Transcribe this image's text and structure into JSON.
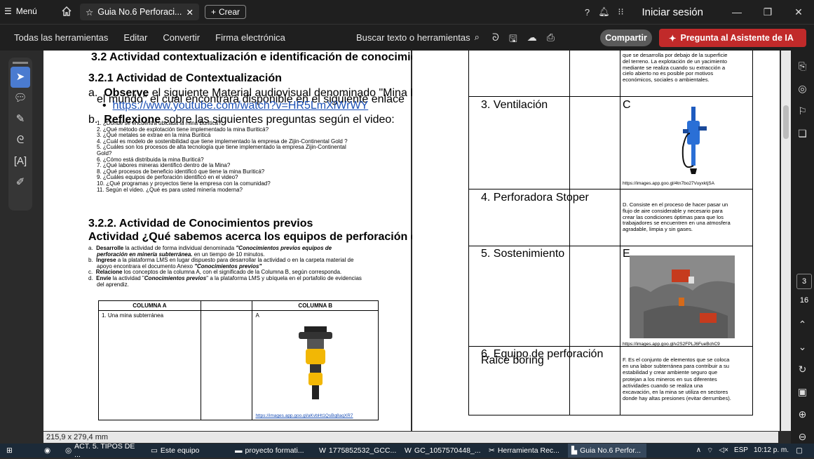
{
  "titlebar": {
    "menu_label": "Menú",
    "tab_title": "Guia No.6 Perforaci...",
    "new_tab": "Crear",
    "signin": "Iniciar sesión"
  },
  "toolbar": {
    "items": [
      "Todas las herramientas",
      "Editar",
      "Convertir",
      "Firma electrónica"
    ],
    "search": "Buscar texto o herramientas",
    "share": "Compartir",
    "ai": "Pregunta al Asistente de IA"
  },
  "page1": {
    "heading": "3.2 Actividad contextualización e identificación de conocimientos previos",
    "s321": "3.2.1 Actividad de Contextualización",
    "a_label": "a.",
    "a_bold": "Observe",
    "a_text": " el siguiente Material audiovisual denominado \"Mina Buriticá, Minería Moderna de Colombia para",
    "a_text2": "el mundo\" el cual encontrará disponible en el siguiente enlace",
    "a_link": "https://www.youtube.com/watch?v=HR5LmXiWrWY",
    "b_label": "b.",
    "b_bold": "Reflexione",
    "b_text": " sobre las siguientes preguntas según el video:",
    "questions": [
      "1.   ¿Dónde se encuentra ubicada la mina Buriticá?",
      "2.   ¿Qué método de explotación tiene implementado la mina Buriticá?",
      "3.   ¿Qué metales se extrae en la mina Buriticá",
      "4.   ¿Cuál es modelo de sostenibilidad que tiene implementado la empresa de Zijin-Continental Gold ?",
      "5.   ¿Cuáles son los procesos de alta tecnología que tiene implementado la empresa Zijin-Continental",
      "       Gold?",
      "6.   ¿Cómo está distribuida la mina Buriticá?",
      "7.   ¿Qué labores mineras identificó dentro de la Mina?",
      "8.   ¿Qué procesos de beneficio identificó que tiene la mina Buriticá?",
      "9.   ¿Cuáles equipos de perforación identificó en el video?",
      "10.  ¿Qué programas y proyectos tiene la empresa con la comunidad?",
      "11.  Según el video. ¿Qué es para usted minería moderna?"
    ],
    "s322": "3.2.2. Actividad de Conocimientos previos",
    "actividad_q": "Actividad ¿Qué sabemos acerca los equipos de perforación que se utilizan en minería Subterránea?",
    "steps": [
      {
        "label": "a.",
        "bold": "Desarrolle",
        "text": " la actividad de forma individual denominada ",
        "italic": "\"Conocimientos previos equipos de",
        "cont": "perforación en minería subterránea.",
        "cont2": "  en un tiempo de 10 minutos."
      },
      {
        "label": "b.",
        "bold": "Ingrese",
        "text": " a la plataforma LMS en lugar dispuesto para desarrollar la actividad o en la carpeta material de",
        "cont": "apoyo encontrara el documento Anexo ",
        "italic": "\"Conocimientos previos\""
      },
      {
        "label": "c.",
        "bold": "Relacione",
        "text": " los conceptos de la columna A, con el significado de la Columna B, según corresponda."
      },
      {
        "label": "d.",
        "bold": "Envíe",
        "text": " la actividad \"",
        "italic": "Conocimientos previos",
        "text2": "\" a la plataforma LMS y ubíquela en el portafolio de evidencias",
        "cont": "del aprendiz."
      }
    ],
    "col_a": "COLUMNA A",
    "col_b": "COLUMNA B",
    "row1_a": "1.   Una mina subterránea",
    "row1_b": "A",
    "row1_link": "https://images.app.goo.gl/aKvbHt1QsBq8aqXR7"
  },
  "page2": {
    "top_text": [
      "que se desarrolla por debajo de la superficie",
      "del terreno. La explotación de un yacimiento",
      "mediante se realiza cuando su extracción a",
      "cielo abierto no es posible por motivos",
      "económicos, sociales o ambientales."
    ],
    "row3_a": "3.   Ventilación",
    "row3_b": "C",
    "row3_link": "https://images.app.goo.gl/4tn7bo27VuyxktjSA",
    "row4_a": "4.   Perforadora Stoper",
    "row4_d": [
      "D. Consiste en el proceso de hacer pasar un",
      "flujo de aire considerable y necesario para",
      "crear las condiciones óptimas para que los",
      "trabajadores se encuentren en una atmosfera",
      "agradable, limpia y sin gases."
    ],
    "row5_a": "5.   Sostenimiento",
    "row5_b": "E",
    "row5_link": "https://images.app.goo.gl/v2S2FPLJ6FueBchC9",
    "row6_a1": "6.   Equipo de perforación",
    "row6_a2": "      Raice boring",
    "row6_f": [
      "F. Es el conjunto de elementos que se coloca",
      "en una labor subterránea para contribuir a su",
      "estabilidad y crear ambiente seguro que",
      "protejan a los mineros en sus diferentes",
      "actividades cuando se realiza una",
      "excavación, en la mina se utiliza en sectores",
      "donde hay altas presiones (evitar derrumbes)."
    ]
  },
  "nav": {
    "page_current": "3",
    "page_total": "16"
  },
  "status": {
    "page_size": "215,9 x 279,4 mm"
  },
  "taskbar": {
    "items": [
      "ACT. 5. TIPOS DE ...",
      "Este equipo",
      "proyecto formati...",
      "1775852532_GCC...",
      "GC_1057570448_...",
      "Herramienta Rec...",
      "Guia No.6 Perfor..."
    ],
    "lang": "ESP",
    "time": "10:12 p. m."
  },
  "colors": {
    "accent": "#4a7bd0",
    "ai_red": "#c12a2a"
  }
}
